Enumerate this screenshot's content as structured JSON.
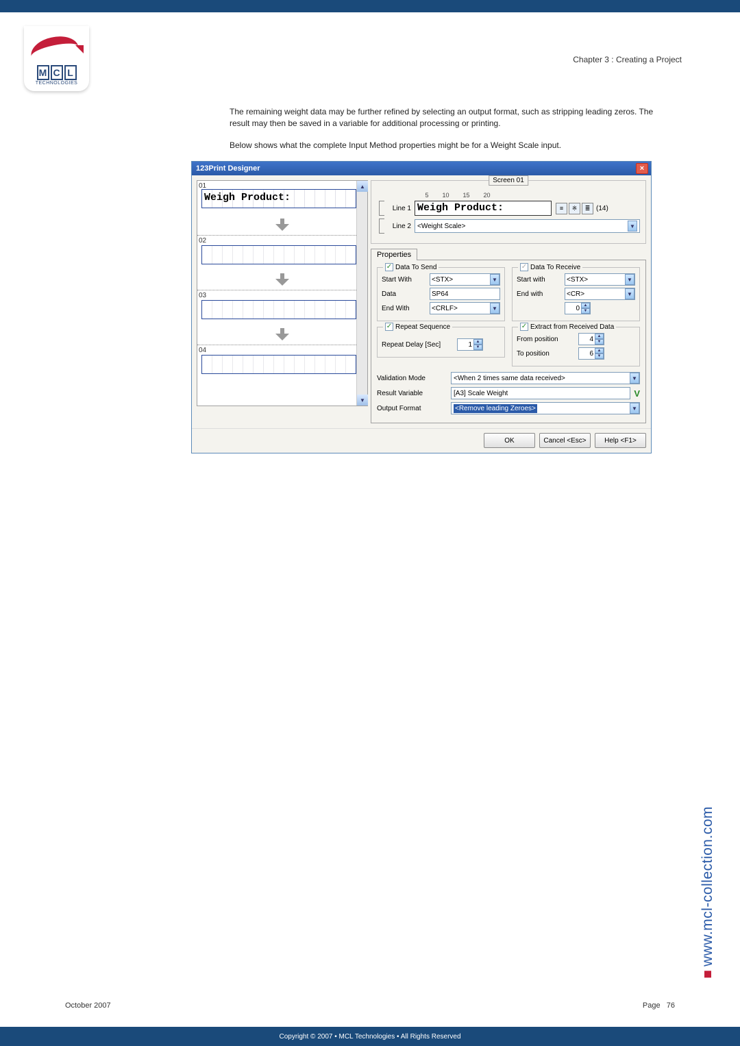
{
  "chapter_header": "Chapter 3 : Creating a Project",
  "logo": {
    "letters": [
      "M",
      "C",
      "L"
    ],
    "sub": "TECHNOLOGIES"
  },
  "paragraph1": "The remaining weight data may be further refined by selecting an output format, such as stripping leading zeros. The result may then be saved in a variable for additional processing or printing.",
  "paragraph2": "Below shows what the complete Input Method properties might be for a Weight Scale input.",
  "dialog": {
    "title": "123Print Designer",
    "slots": {
      "s1": "01",
      "s2": "02",
      "s3": "03",
      "s4": "04",
      "box1_text": "Weigh Product:"
    },
    "screen_legend": "Screen 01",
    "ruler": "         5        10        15        20",
    "line1": {
      "label": "Line 1",
      "value": "Weigh Product:",
      "end": "(14)"
    },
    "line2": {
      "label": "Line 2",
      "value": "<Weight Scale>"
    },
    "tab": "Properties",
    "send": {
      "legend": "Data To Send",
      "start_label": "Start With",
      "data_label": "Data",
      "end_label": "End With",
      "start": "<STX>",
      "data": "SP64",
      "end": "<CRLF>"
    },
    "receive": {
      "legend": "Data To Receive",
      "start_label": "Start with",
      "end_label": "End with",
      "start": "<STX>",
      "end": "<CR>",
      "spinner_val": "0"
    },
    "repeat": {
      "legend": "Repeat Sequence",
      "delay_label": "Repeat Delay [Sec]",
      "delay": "1"
    },
    "extract": {
      "legend": "Extract from Received Data",
      "from_label": "From position",
      "to_label": "To position",
      "from": "4",
      "to": "6"
    },
    "validation": {
      "mode_label": "Validation Mode",
      "result_label": "Result Variable",
      "output_label": "Output Format",
      "mode": "<When 2 times same data received>",
      "result": "[A3] Scale Weight",
      "output": "<Remove leading Zeroes>"
    },
    "buttons": {
      "ok": "OK",
      "cancel": "Cancel <Esc>",
      "help": "Help <F1>"
    }
  },
  "side_url": "www.mcl-collection.com",
  "footer_left": "October 2007",
  "footer_right_label": "Page",
  "footer_right_num": "76",
  "bottom_bar": "Copyright © 2007 • MCL Technologies • All Rights Reserved"
}
